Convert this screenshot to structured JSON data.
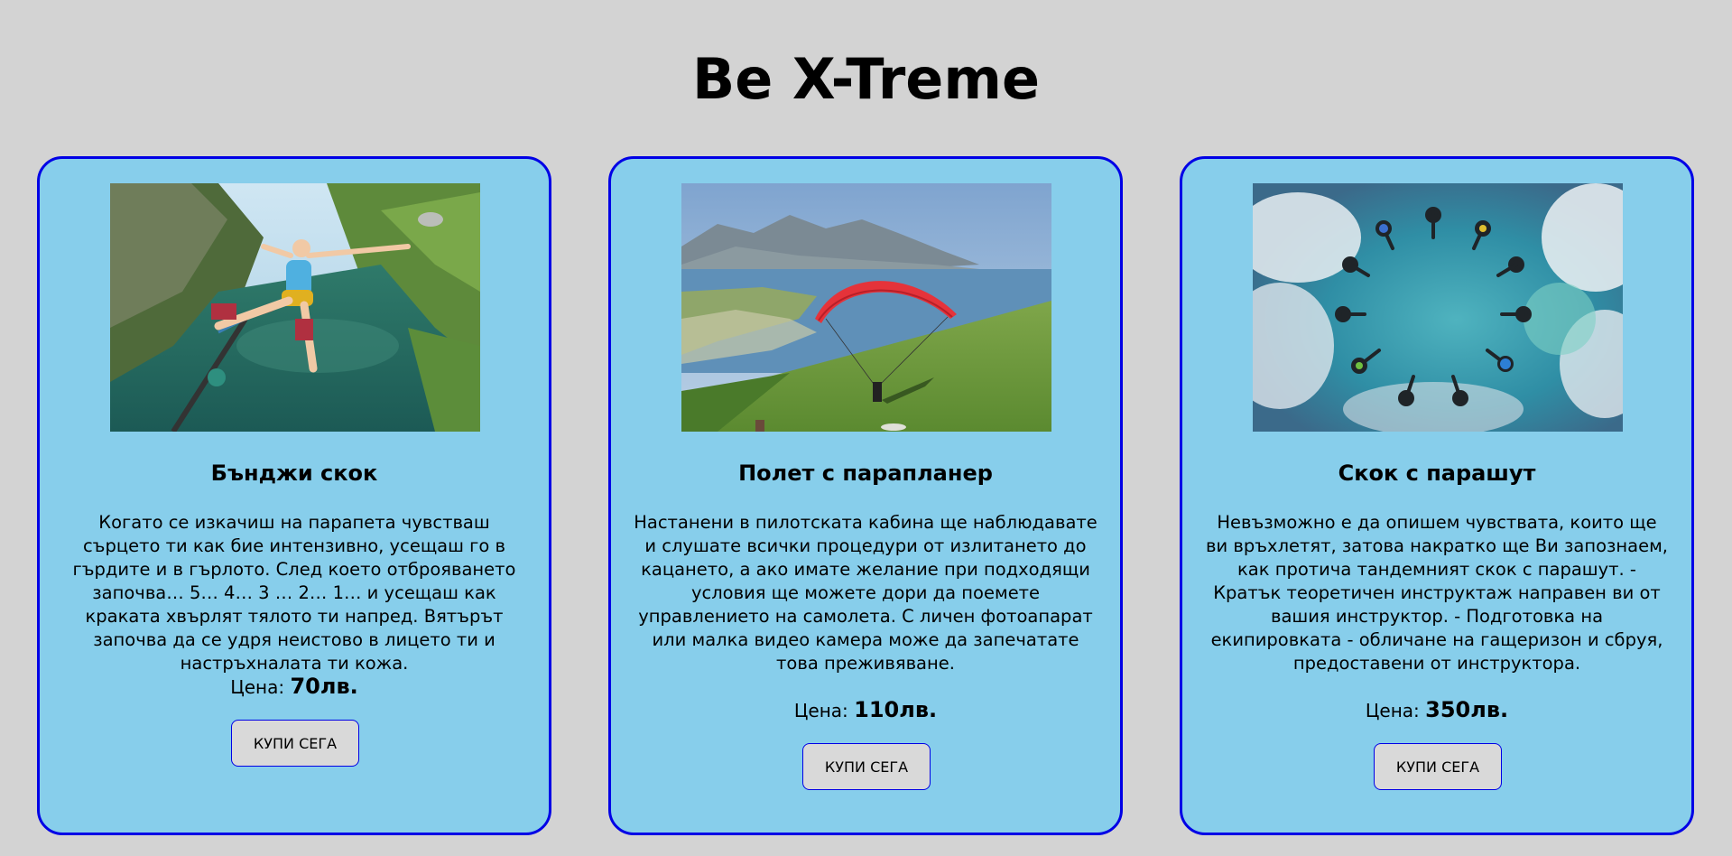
{
  "page": {
    "title": "Be X-Treme"
  },
  "cards": [
    {
      "image_subject": "bungee-jump-over-mountain-lake",
      "title": "Бънджи скок",
      "description": "Когато се изкачиш на парапета чувстваш сърцето ти как бие интензивно, усещаш го в гърдите и в гърлото. След което отброяването започва… 5… 4… 3 … 2… 1… и усещаш как краката хвърлят тялото ти напред. Вятърът започва да се удря неистово в лицето ти и настръхналата ти кожа.",
      "price_label": "Цена:",
      "price_value": "70лв.",
      "button_label": "КУПИ СЕГА"
    },
    {
      "image_subject": "paraglider-over-green-slope-and-lake",
      "title": "Полет с парапланер",
      "description": "Настанени в пилотската кабина ще наблюдавате и слушате всички процедури от излитането до кацането, а ако имате желание при подходящи условия ще можете дори да поемете управлението на самолета. С личен фотоапарат или малка видео камера може да запечатате това преживяване.",
      "price_label": "Цена:",
      "price_value": "110лв.",
      "button_label": "КУПИ СЕГА"
    },
    {
      "image_subject": "skydivers-formation-ring-over-clouds-and-sea",
      "title": "Скок с парашут",
      "description": "Невъзможно е да опишем чувствата, които ще ви връхлетят, затова накратко ще Ви запознаем, как протича тандемният скок с парашут. - Кратък теоретичен инструктаж направен ви от вашия инструктор. - Подготовка на екипировката - обличане на гащеризон и сбруя, предоставени от инструктора.",
      "price_label": "Цена:",
      "price_value": "350лв.",
      "button_label": "КУПИ СЕГА"
    }
  ],
  "colors": {
    "page_background": "#d3d3d3",
    "card_background": "#87ceeb",
    "card_border": "#0000e6",
    "button_background": "#d9d9d9"
  }
}
